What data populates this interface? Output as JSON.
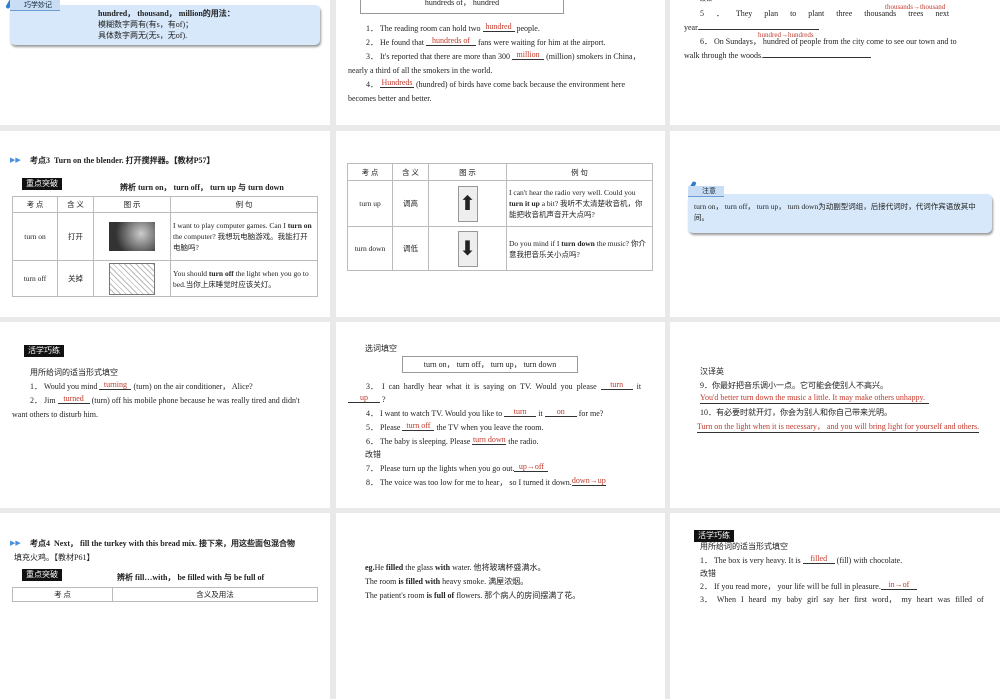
{
  "slide1": {
    "tip_label": "巧学妙记",
    "line1": "hundred， thousand， million的用法：",
    "line2": "模糊数字两有(有s，有of)；",
    "line3": "具体数字两无(无s，无of)."
  },
  "slide2": {
    "box": "hundreds of， hundred",
    "q1": [
      "1． The reading room can hold two ",
      "hundred",
      " people."
    ],
    "q2": [
      "2． He found that ",
      "hundreds of",
      " fans were waiting for him at the airport."
    ],
    "q3": [
      "3． It's reported that there are more than 300 ",
      "million",
      " (million) smokers in China，"
    ],
    "q3b": "nearly a third of all the smokers in the world.",
    "q4": [
      "4． ",
      "Hundreds",
      " (hundred) of birds have come back because the environment here"
    ],
    "q4b": "becomes better and better."
  },
  "slide3": {
    "top": "改错",
    "q5": "5 ． They plan to plant three thousands trees next",
    "q5_fix": "thousands→thousand",
    "q5b": "year.",
    "q6": "6． On Sundays， hundred of people from the city come to see our town and to",
    "q6_fix": "hundred→hundreds",
    "q6b": "walk through the woods."
  },
  "slide4": {
    "heading_prefix": "考点3",
    "heading": "Turn on the blender. 打开搅拌器。【教材P57】",
    "badge": "重点突破",
    "subtitle": "辨析 turn on， turn off， turn up 与 turn down",
    "headers": [
      "考 点",
      "含 义",
      "图 示",
      "例 句"
    ],
    "rows": [
      {
        "point": "turn on",
        "meaning": "打开",
        "ex_a": "I want to play computer games. Can I ",
        "ex_bold": "turn on",
        "ex_b": " the computer? 我想玩电脑游戏。我能打开电脑吗?"
      },
      {
        "point": "turn off",
        "meaning": "关掉",
        "ex_a": "You should ",
        "ex_bold": "turn off",
        "ex_b": " the light when you go to bed.当你上床睡觉时应该关灯。"
      }
    ]
  },
  "slide5": {
    "headers": [
      "考 点",
      "含 义",
      "图 示",
      "例 句"
    ],
    "rows": [
      {
        "point": "turn up",
        "meaning": "调高",
        "ex_a": "I can't hear the radio very well. Could you ",
        "ex_bold": "turn it up",
        "ex_b": " a bit? 我听不太清楚收音机，你能把收音机声音开大点吗?"
      },
      {
        "point": "turn down",
        "meaning": "调低",
        "ex_a": "Do you mind if I ",
        "ex_bold": "turn down",
        "ex_b": " the music? 你介意我把音乐关小点吗?"
      }
    ]
  },
  "slide6": {
    "label": "注意",
    "text": "turn on， turn off， turn up， turn down为动副型词组，后接代词时，代词作宾语放其中间。"
  },
  "slide7": {
    "badge": "活学巧练",
    "instr": "用所给词的适当形式填空",
    "q1": [
      "1． Would you mind ",
      "turning",
      " (turn) on the air conditioner， Alice?"
    ],
    "q2": [
      "2． Jim ",
      "turned",
      " (turn) off his mobile phone because he was really tired and didn't"
    ],
    "q2b": "want others to disturb him."
  },
  "slide8": {
    "title": "选词填空",
    "box": "turn on， turn off， turn up， turn down",
    "q3": [
      "3． I can hardly hear what it is saying on TV. Would you please ",
      "turn",
      " it"
    ],
    "q3b": [
      "up",
      " ?"
    ],
    "q4": [
      "4． I want to watch TV. Would you like to ",
      "turn",
      " it ",
      "on",
      " for me?"
    ],
    "q5": [
      "5． Please ",
      "turn off",
      " the TV when you leave the room."
    ],
    "q6": [
      "6． The baby is sleeping. Please ",
      "turn down",
      " the radio."
    ],
    "sub": "改错",
    "q7": [
      "7． Please turn up the lights when you go out.",
      "up→off"
    ],
    "q8": [
      "8． The voice was too low for me to hear， so I turned it down.",
      "down→up"
    ]
  },
  "slide9": {
    "title": "汉译英",
    "q9": "9．你最好把音乐调小一点。它可能会使别人不高兴。",
    "a9": "You'd better turn down the music a little. It may make others unhappy.",
    "q10": "10．有必要时就开灯，你会为别人和你自己带来光明。",
    "a10": "Turn on the light when it is necessary， and you will bring light for yourself and others."
  },
  "slide10": {
    "heading_prefix": "考点4",
    "heading": "Next， fill the turkey with this bread mix. 接下来，用这些面包混合物",
    "heading2": "填充火鸡。【教材P61】",
    "badge": "重点突破",
    "subtitle": "辨析 fill…with， be filled with 与 be full of",
    "headers": [
      "考 点",
      "含义及用法"
    ]
  },
  "slide11": {
    "l1": [
      "eg.",
      "He ",
      "filled",
      " the glass ",
      "with",
      " water. 他将玻璃杯盛满水。"
    ],
    "l2": [
      "The room ",
      "is filled with",
      " heavy smoke. 满屋浓烟。"
    ],
    "l3": [
      "The patient's room ",
      "is full of",
      " flowers. 那个病人的房间摆满了花。"
    ]
  },
  "slide12": {
    "badge": "活学巧练",
    "instr": "用所给词的适当形式填空",
    "q1": [
      "1． The box is very heavy. It is ",
      "filled",
      " (fill) with chocolate."
    ],
    "sub": "改错",
    "q2": [
      "2． If you read more， your life will be full in pleasure.",
      "in→of"
    ],
    "q3": "3． When I heard my baby girl say her first word， my heart was filled of"
  },
  "colors": {
    "answer": "#c0392b",
    "tip_bg": "#d6e8fa",
    "gap": "#e9e9e9"
  }
}
